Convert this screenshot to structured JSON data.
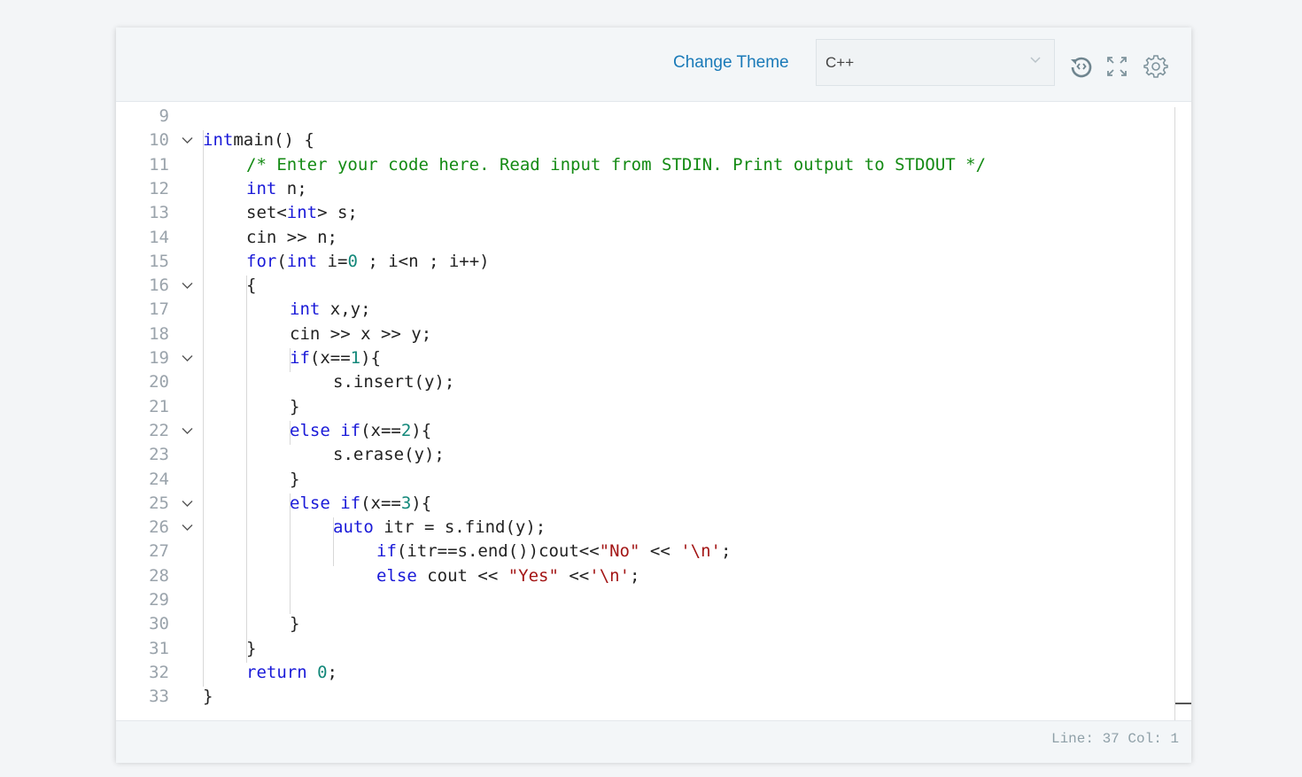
{
  "toolbar": {
    "change_theme_label": "Change Theme",
    "language_selected": "C++",
    "icons": [
      "restore-code-icon",
      "fullscreen-icon",
      "settings-gear-icon"
    ]
  },
  "editor": {
    "lines": [
      {
        "n": "9",
        "fold": false,
        "indent": 0,
        "tokens": []
      },
      {
        "n": "10",
        "fold": true,
        "indent": 0,
        "tokens": [
          [
            "kw",
            "int"
          ],
          [
            "",
            "main() {"
          ]
        ]
      },
      {
        "n": "11",
        "fold": false,
        "indent": 1,
        "tokens": [
          [
            "cm",
            "/* Enter your code here. Read input from STDIN. Print output to STDOUT */"
          ]
        ]
      },
      {
        "n": "12",
        "fold": false,
        "indent": 1,
        "tokens": [
          [
            "kw",
            "int"
          ],
          [
            "",
            " n;"
          ]
        ]
      },
      {
        "n": "13",
        "fold": false,
        "indent": 1,
        "tokens": [
          [
            "",
            "set<"
          ],
          [
            "kw",
            "int"
          ],
          [
            "",
            "> s;"
          ]
        ]
      },
      {
        "n": "14",
        "fold": false,
        "indent": 1,
        "tokens": [
          [
            "",
            "cin >> n;"
          ]
        ]
      },
      {
        "n": "15",
        "fold": false,
        "indent": 1,
        "tokens": [
          [
            "kw",
            "for"
          ],
          [
            "",
            "("
          ],
          [
            "kw",
            "int"
          ],
          [
            "",
            " i="
          ],
          [
            "num",
            "0"
          ],
          [
            "",
            " ; i<n ; i++)"
          ]
        ]
      },
      {
        "n": "16",
        "fold": true,
        "indent": 1,
        "tokens": [
          [
            "",
            "{"
          ]
        ]
      },
      {
        "n": "17",
        "fold": false,
        "indent": 2,
        "tokens": [
          [
            "kw",
            "int"
          ],
          [
            "",
            " x,y;"
          ]
        ]
      },
      {
        "n": "18",
        "fold": false,
        "indent": 2,
        "tokens": [
          [
            "",
            "cin >> x >> y;"
          ]
        ]
      },
      {
        "n": "19",
        "fold": true,
        "indent": 2,
        "tokens": [
          [
            "kw",
            "if"
          ],
          [
            "",
            "(x=="
          ],
          [
            "num",
            "1"
          ],
          [
            "",
            "){"
          ]
        ]
      },
      {
        "n": "20",
        "fold": false,
        "indent": 3,
        "tokens": [
          [
            "",
            "s.insert(y);"
          ]
        ]
      },
      {
        "n": "21",
        "fold": false,
        "indent": 2,
        "tokens": [
          [
            "",
            "}"
          ]
        ]
      },
      {
        "n": "22",
        "fold": true,
        "indent": 2,
        "tokens": [
          [
            "kw",
            "else if"
          ],
          [
            "",
            "(x=="
          ],
          [
            "num",
            "2"
          ],
          [
            "",
            "){"
          ]
        ]
      },
      {
        "n": "23",
        "fold": false,
        "indent": 3,
        "tokens": [
          [
            "",
            "s.erase(y);"
          ]
        ]
      },
      {
        "n": "24",
        "fold": false,
        "indent": 2,
        "tokens": [
          [
            "",
            "}"
          ]
        ]
      },
      {
        "n": "25",
        "fold": true,
        "indent": 2,
        "tokens": [
          [
            "kw",
            "else if"
          ],
          [
            "",
            "(x=="
          ],
          [
            "num",
            "3"
          ],
          [
            "",
            "){"
          ]
        ]
      },
      {
        "n": "26",
        "fold": true,
        "indent": 3,
        "tokens": [
          [
            "kw",
            "auto"
          ],
          [
            "",
            " itr = s.find(y);"
          ]
        ]
      },
      {
        "n": "27",
        "fold": false,
        "indent": 4,
        "tokens": [
          [
            "kw",
            "if"
          ],
          [
            "",
            "(itr==s.end())cout<<"
          ],
          [
            "str",
            "\"No\""
          ],
          [
            "",
            " << "
          ],
          [
            "str",
            "'\\n'"
          ],
          [
            "",
            ";"
          ]
        ]
      },
      {
        "n": "28",
        "fold": false,
        "indent": 4,
        "tokens": [
          [
            "kw",
            "else"
          ],
          [
            "",
            " cout << "
          ],
          [
            "str",
            "\"Yes\""
          ],
          [
            "",
            " <<"
          ],
          [
            "str",
            "'\\n'"
          ],
          [
            "",
            ";"
          ]
        ]
      },
      {
        "n": "29",
        "fold": false,
        "indent": 0,
        "tokens": []
      },
      {
        "n": "30",
        "fold": false,
        "indent": 2,
        "tokens": [
          [
            "",
            "}"
          ]
        ]
      },
      {
        "n": "31",
        "fold": false,
        "indent": 1,
        "tokens": [
          [
            "",
            "}"
          ]
        ]
      },
      {
        "n": "32",
        "fold": false,
        "indent": 1,
        "tokens": [
          [
            "kw",
            "return"
          ],
          [
            "",
            " "
          ],
          [
            "num",
            "0"
          ],
          [
            "",
            ";"
          ]
        ]
      },
      {
        "n": "33",
        "fold": false,
        "indent": 0,
        "tokens": [
          [
            "",
            "}"
          ]
        ]
      }
    ]
  },
  "status": {
    "cursor_text": "Line: 37 Col: 1"
  }
}
